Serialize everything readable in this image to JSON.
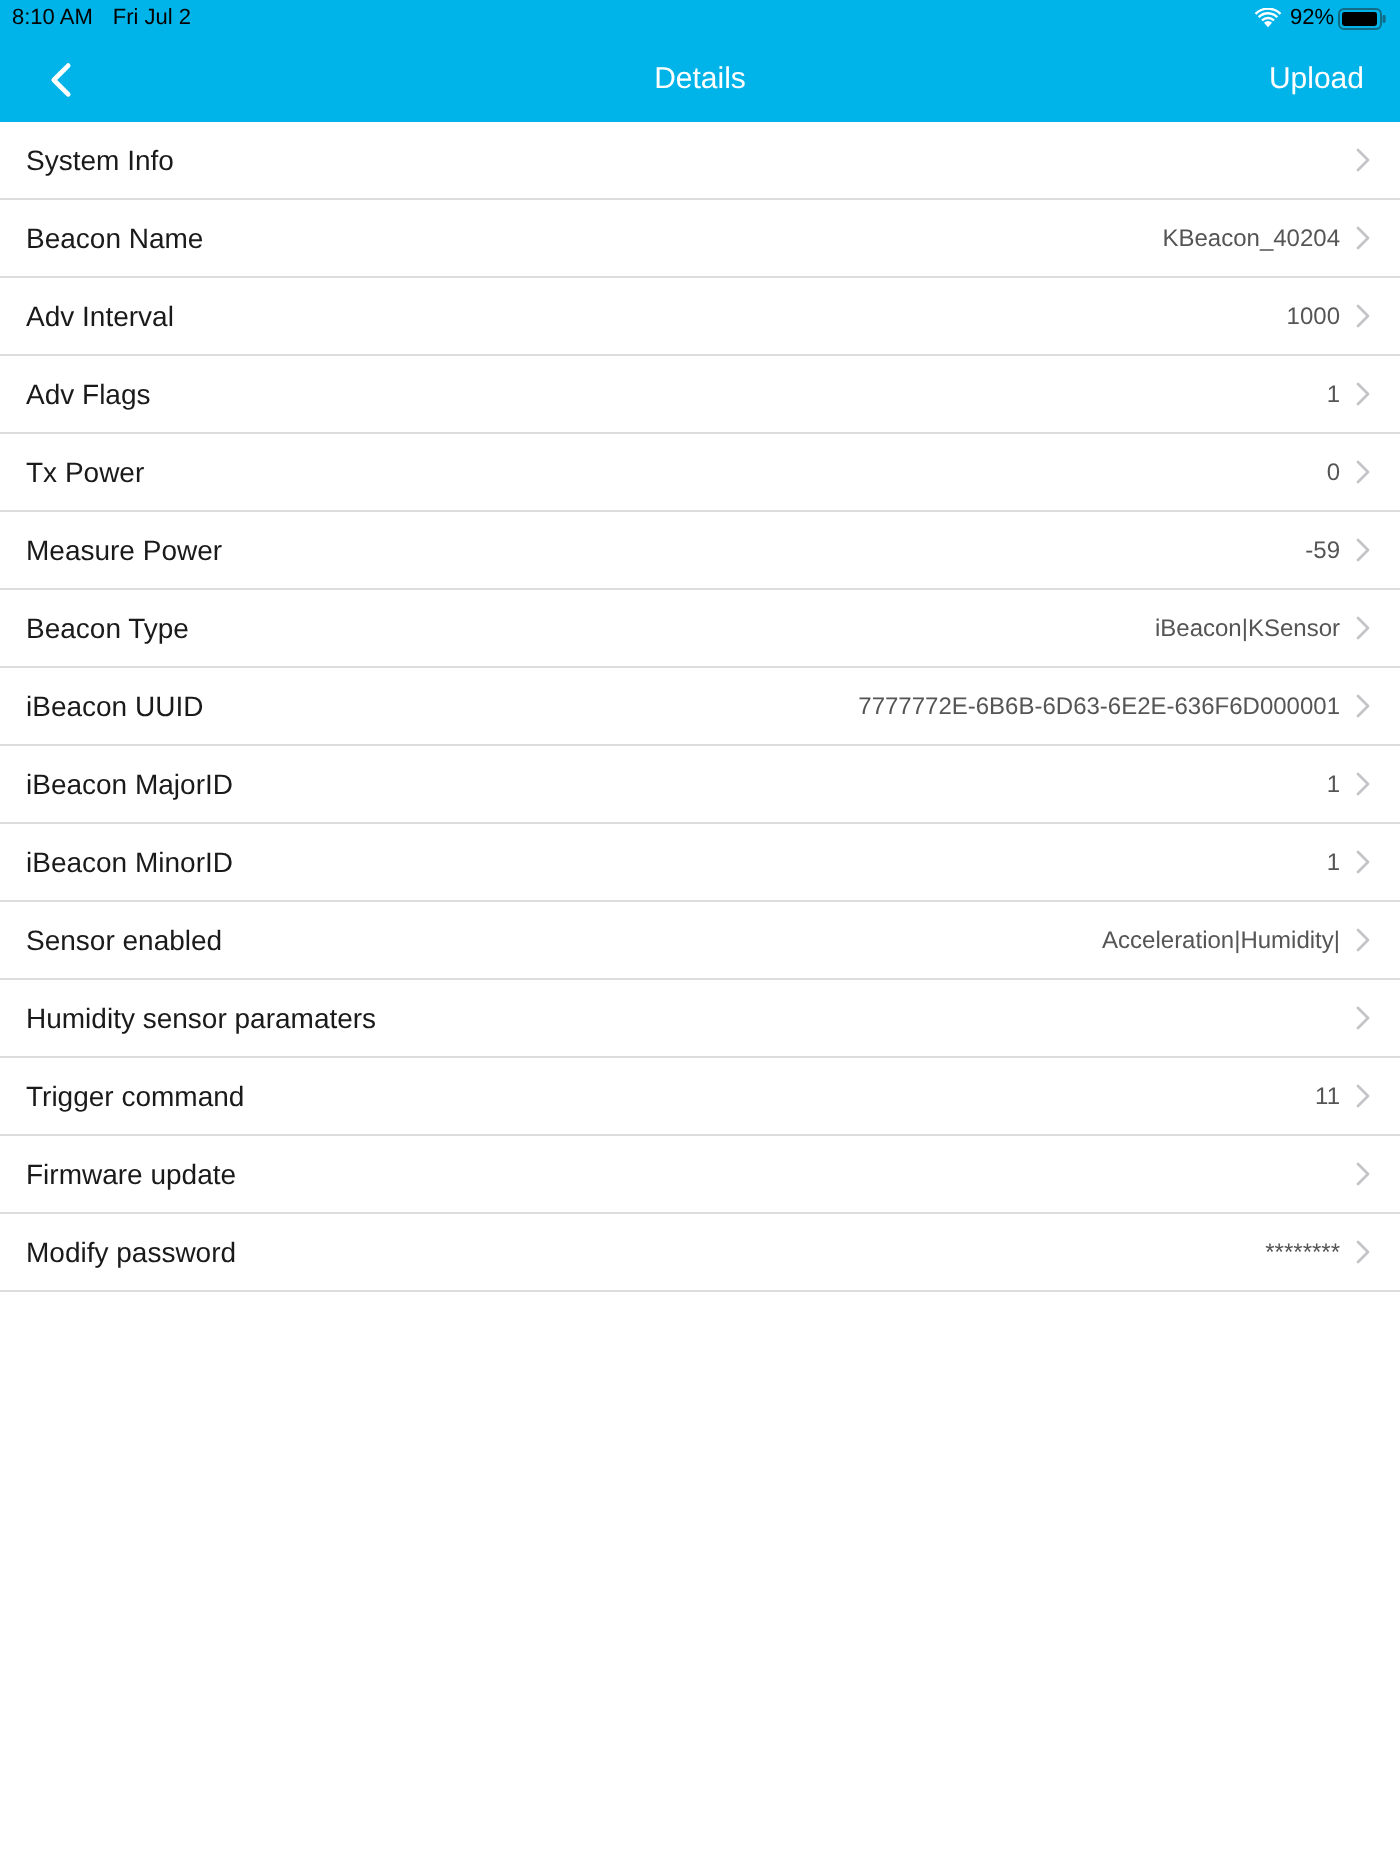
{
  "status_bar": {
    "time": "8:10 AM",
    "date": "Fri Jul 2",
    "battery": "92%"
  },
  "nav_bar": {
    "title": "Details",
    "action": "Upload"
  },
  "rows": [
    {
      "label": "System Info"
    },
    {
      "label": "Beacon Name",
      "value": "KBeacon_40204"
    },
    {
      "label": "Adv Interval",
      "value": "1000"
    },
    {
      "label": "Adv Flags",
      "value": "1"
    },
    {
      "label": "Tx Power",
      "value": "0"
    },
    {
      "label": "Measure Power",
      "value": "-59"
    },
    {
      "label": "Beacon Type",
      "value": "iBeacon|KSensor"
    },
    {
      "label": "iBeacon UUID",
      "value": "7777772E-6B6B-6D63-6E2E-636F6D000001"
    },
    {
      "label": "iBeacon MajorID",
      "value": "1"
    },
    {
      "label": "iBeacon MinorID",
      "value": "1"
    },
    {
      "label": "Sensor enabled",
      "value": "Acceleration|Humidity|"
    },
    {
      "label": "Humidity sensor paramaters"
    },
    {
      "label": "Trigger command",
      "value": "11"
    },
    {
      "label": "Firmware update"
    },
    {
      "label": "Modify password",
      "value": "********"
    }
  ]
}
